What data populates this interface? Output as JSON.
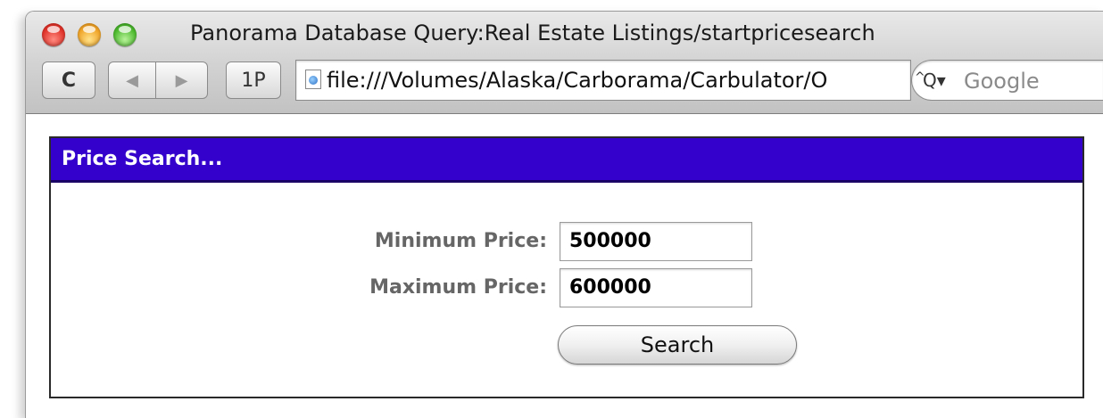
{
  "window": {
    "title": "Panorama Database Query:Real Estate Listings/startpricesearch"
  },
  "toolbar": {
    "reload_label": "C",
    "back_label": "◀",
    "forward_label": "▶",
    "onepassword_label": "1P",
    "url": "file:///Volumes/Alaska/Carborama/Carbulator/O",
    "search_placeholder": "Google",
    "search_icon": "Q▾"
  },
  "panel": {
    "title": "Price Search...",
    "min_label": "Minimum Price:",
    "min_value": "500000",
    "max_label": "Maximum Price:",
    "max_value": "600000",
    "search_button": "Search"
  },
  "colors": {
    "header_bg": "#3300cc",
    "header_text": "#ffffff",
    "label_text": "#666666"
  }
}
